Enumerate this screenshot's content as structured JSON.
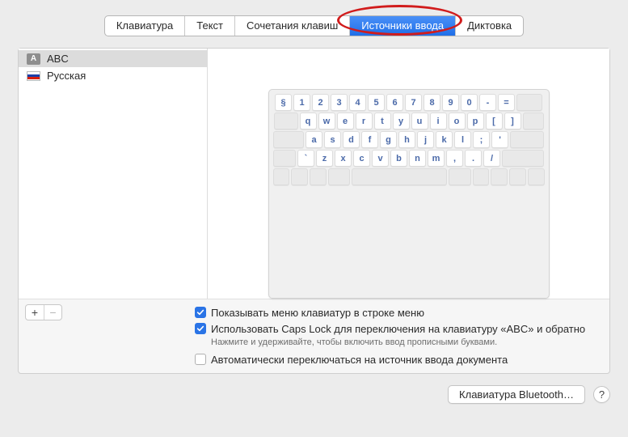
{
  "tabs": {
    "keyboard": "Клавиатура",
    "text": "Текст",
    "shortcuts": "Сочетания клавиш",
    "input_sources": "Источники ввода",
    "dictation": "Диктовка",
    "active": "input_sources"
  },
  "sources": {
    "items": [
      {
        "icon": "A",
        "label": "ABC",
        "selected": true
      },
      {
        "icon": "ru-flag",
        "label": "Русская",
        "selected": false
      }
    ]
  },
  "keyboard_layout": {
    "row1": [
      "§",
      "1",
      "2",
      "3",
      "4",
      "5",
      "6",
      "7",
      "8",
      "9",
      "0",
      "-",
      "="
    ],
    "row2": [
      "q",
      "w",
      "e",
      "r",
      "t",
      "y",
      "u",
      "i",
      "o",
      "p",
      "[",
      "]"
    ],
    "row3": [
      "a",
      "s",
      "d",
      "f",
      "g",
      "h",
      "j",
      "k",
      "l",
      ";",
      "'"
    ],
    "row4": [
      "`",
      "z",
      "x",
      "c",
      "v",
      "b",
      "n",
      "m",
      ",",
      ".",
      "/"
    ]
  },
  "buttons": {
    "plus": "+",
    "minus": "−",
    "bluetooth": "Клавиатура Bluetooth…",
    "help": "?"
  },
  "checks": {
    "show_menu": {
      "checked": true,
      "label": "Показывать меню клавиатур в строке меню"
    },
    "capslock": {
      "checked": true,
      "label": "Использовать Caps Lock для переключения на клавиатуру «ABC» и обратно"
    },
    "capslock_hint": "Нажмите и удерживайте, чтобы включить ввод прописными буквами.",
    "auto_switch": {
      "checked": false,
      "label": "Автоматически переключаться на источник ввода документа"
    }
  },
  "colors": {
    "accent": "#2a74e6",
    "annotation": "#d11c1c",
    "ru_flag": [
      "#ffffff",
      "#1c3fa8",
      "#d7200f"
    ]
  }
}
